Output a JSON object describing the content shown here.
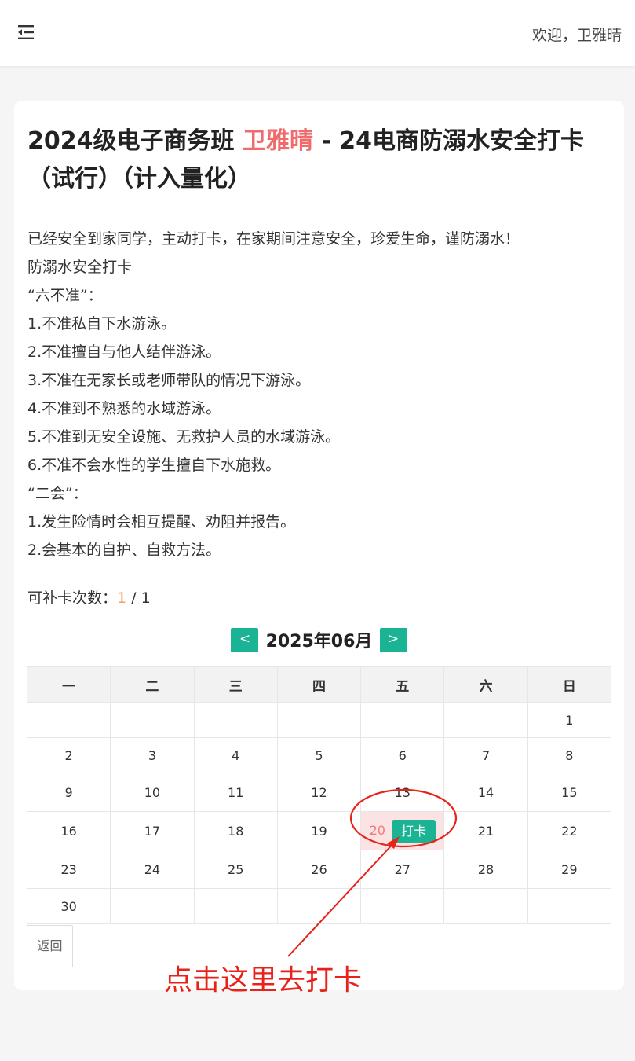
{
  "header": {
    "menu_icon": "menu-fold-icon",
    "welcome": "欢迎，卫雅晴"
  },
  "task": {
    "title_prefix": "2024级电子商务班 ",
    "student_name": "卫雅晴",
    "title_suffix": " - 24电商防溺水安全打卡（试行）（计入量化）",
    "description": [
      "已经安全到家同学，主动打卡，在家期间注意安全，珍爱生命，谨防溺水！",
      "防溺水安全打卡",
      "“六不准”：",
      "1.不准私自下水游泳。",
      "2.不准擅自与他人结伴游泳。",
      "3.不准在无家长或老师带队的情况下游泳。",
      "4.不准到不熟悉的水域游泳。",
      "5.不准到无安全设施、无救护人员的水域游泳。",
      "6.不准不会水性的学生擅自下水施救。",
      "“二会”：",
      "1.发生险情时会相互提醒、劝阻并报告。",
      "2.会基本的自护、自救方法。"
    ],
    "retry_label": "可补卡次数：",
    "retry_used": "1",
    "retry_sep": " / ",
    "retry_total": "1"
  },
  "calendar": {
    "prev_label": "<",
    "month_label": "2025年06月",
    "next_label": ">",
    "weekdays": [
      "一",
      "二",
      "三",
      "四",
      "五",
      "六",
      "日"
    ],
    "weeks": [
      [
        "",
        "",
        "",
        "",
        "",
        "",
        "1"
      ],
      [
        "2",
        "3",
        "4",
        "5",
        "6",
        "7",
        "8"
      ],
      [
        "9",
        "10",
        "11",
        "12",
        "13",
        "14",
        "15"
      ],
      [
        "16",
        "17",
        "18",
        "19",
        "20",
        "21",
        "22"
      ],
      [
        "23",
        "24",
        "25",
        "26",
        "27",
        "28",
        "29"
      ],
      [
        "30",
        "",
        "",
        "",
        "",
        "",
        ""
      ]
    ],
    "today": "20",
    "checkin_label": "打卡"
  },
  "back_label": "返回",
  "annotation": {
    "text": "点击这里去打卡",
    "color": "#e8221a"
  },
  "colors": {
    "accent": "#1ab394",
    "name_highlight": "#f06b6b",
    "today_bg": "#fbe3e3"
  }
}
